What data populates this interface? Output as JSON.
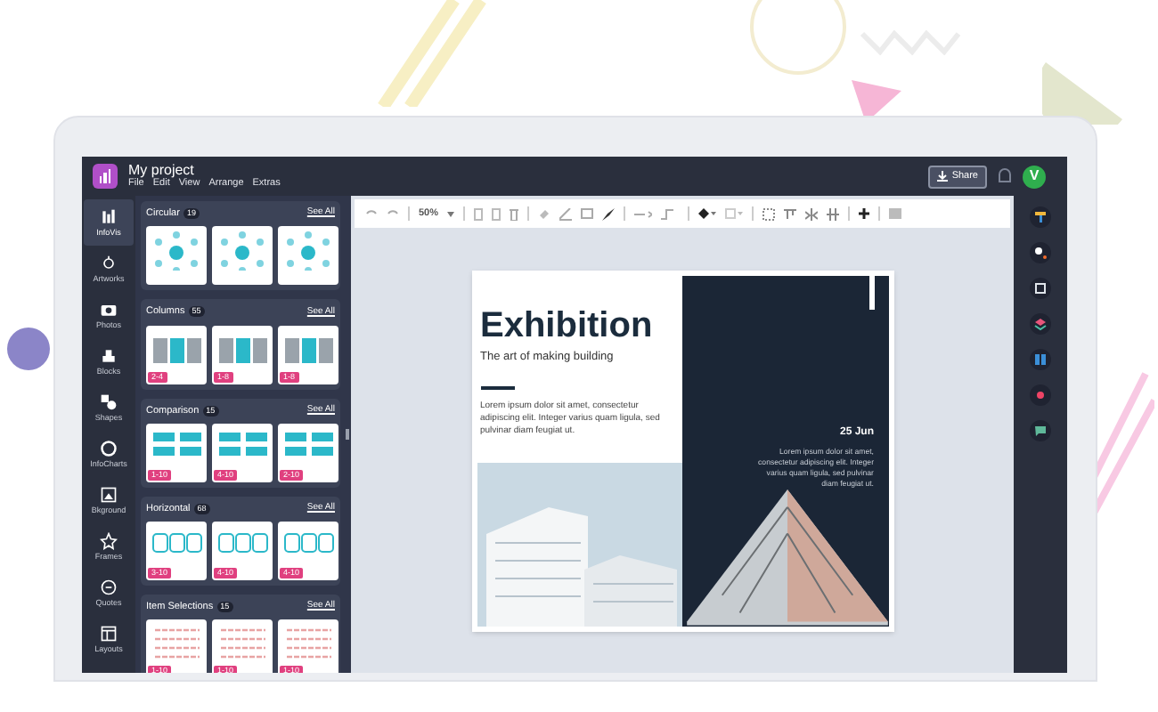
{
  "app": {
    "title": "My project",
    "menu": [
      "File",
      "Edit",
      "View",
      "Arrange",
      "Extras"
    ],
    "share": "Share",
    "avatar": "V"
  },
  "rail": [
    {
      "label": "InfoVis",
      "selected": true
    },
    {
      "label": "Artworks",
      "selected": false
    },
    {
      "label": "Photos",
      "selected": false
    },
    {
      "label": "Blocks",
      "selected": false
    },
    {
      "label": "Shapes",
      "selected": false
    },
    {
      "label": "InfoCharts",
      "selected": false
    },
    {
      "label": "Bkground",
      "selected": false
    },
    {
      "label": "Frames",
      "selected": false
    },
    {
      "label": "Quotes",
      "selected": false
    },
    {
      "label": "Layouts",
      "selected": false
    }
  ],
  "panel": {
    "sections": [
      {
        "title": "Circular",
        "count": "19",
        "link": "See All",
        "thumbnails": [
          {
            "kind": "circular"
          },
          {
            "kind": "circular"
          },
          {
            "kind": "circular"
          }
        ]
      },
      {
        "title": "Columns",
        "count": "55",
        "link": "See All",
        "thumbnails": [
          {
            "kind": "columns",
            "badge": "2-4"
          },
          {
            "kind": "columns",
            "badge": "1-8"
          },
          {
            "kind": "columns",
            "badge": "1-8"
          }
        ]
      },
      {
        "title": "Comparison",
        "count": "15",
        "link": "See All",
        "thumbnails": [
          {
            "kind": "comparison",
            "badge": "1-10"
          },
          {
            "kind": "comparison",
            "badge": "4-10"
          },
          {
            "kind": "comparison",
            "badge": "2-10"
          }
        ]
      },
      {
        "title": "Horizontal",
        "count": "68",
        "link": "See All",
        "thumbnails": [
          {
            "kind": "horizontal",
            "badge": "3-10"
          },
          {
            "kind": "horizontal",
            "badge": "4-10"
          },
          {
            "kind": "horizontal",
            "badge": "4-10"
          }
        ]
      },
      {
        "title": "Item Selections",
        "count": "15",
        "link": "See All",
        "thumbnails": [
          {
            "kind": "list",
            "badge": "1-10"
          },
          {
            "kind": "list",
            "badge": "1-10"
          },
          {
            "kind": "list",
            "badge": "1-10"
          }
        ]
      }
    ]
  },
  "toolbar": {
    "zoom": "50%"
  },
  "document": {
    "title": "Exhibition",
    "subtitle": "The art of making building",
    "body": "Lorem ipsum dolor sit amet, consectetur adipiscing elit. Integer varius quam ligula, sed pulvinar diam feugiat ut.",
    "date": "25 Jun",
    "side_text": "Lorem ipsum dolor sit amet, consectetur adipiscing elit. Integer varius quam ligula, sed pulvinar diam feugiat ut."
  }
}
